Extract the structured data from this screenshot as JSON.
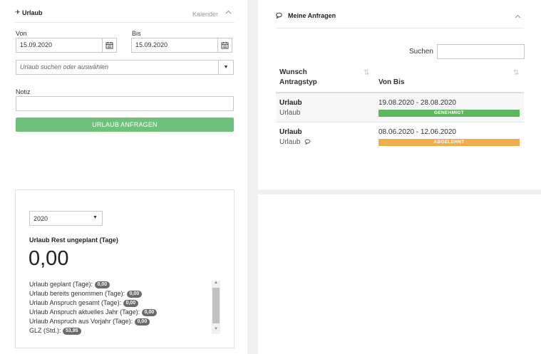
{
  "urlaub_panel": {
    "title": "Urlaub",
    "kalender_link": "Kalender",
    "von_label": "Von",
    "von_value": "15.09.2020",
    "bis_label": "Bis",
    "bis_value": "15.09.2020",
    "urlaub_select_placeholder": "Urlaub suchen oder auswählen",
    "notiz_label": "Notiz",
    "notiz_value": "",
    "apply_button": "URLAUB ANFRAGEN"
  },
  "stats_panel": {
    "year": "2020",
    "rest_label": "Urlaub Rest ungeplant (Tage)",
    "rest_value": "0,00",
    "rows": [
      {
        "label": "Urlaub geplant (Tage):",
        "value": "0,00"
      },
      {
        "label": "Urlaub bereits genommen (Tage):",
        "value": "0,00"
      },
      {
        "label": "Urlaub Anspruch gesamt (Tage):",
        "value": "0,00"
      },
      {
        "label": "Urlaub Anspruch aktuelles Jahr (Tage):",
        "value": "0,00"
      },
      {
        "label": "Urlaub Anspruch aus Vorjahr (Tage):",
        "value": "0,00"
      },
      {
        "label": "GLZ (Std.):",
        "value": "53,95"
      }
    ]
  },
  "anfragen_panel": {
    "title": "Meine Anfragen",
    "search_label": "Suchen",
    "search_value": "",
    "col1_line1": "Wunsch",
    "col1_line2": "Antragstyp",
    "col2": "Von Bis",
    "rows": [
      {
        "wunsch": "Urlaub",
        "typ": "Urlaub",
        "dates": "19.08.2020 - 28.08.2020",
        "status": "GENEHMIGT",
        "status_color": "#5cb85c",
        "has_comment": false
      },
      {
        "wunsch": "Urlaub",
        "typ": "Urlaub",
        "dates": "08.06.2020 - 12.06.2020",
        "status": "ABGELEHNT",
        "status_color": "#f0ad4e",
        "has_comment": true
      }
    ]
  }
}
